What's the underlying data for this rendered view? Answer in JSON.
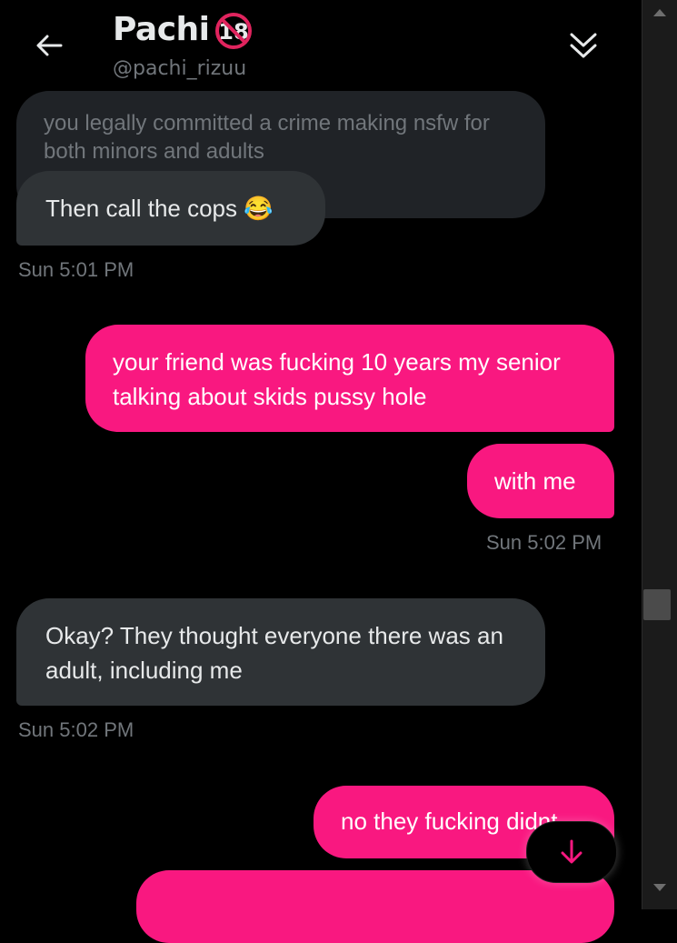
{
  "header": {
    "name": "Pachi",
    "handle": "@pachi_rizuu",
    "badge_text": "18"
  },
  "messages": {
    "quoted": "you legally committed a crime making nsfw for both minors and adults",
    "m1": "Then call the cops 😂",
    "t1": "Sun 5:01 PM",
    "m2": "your friend was fucking 10 years my senior talking about skids pussy hole",
    "m3": "with me",
    "t2": "Sun 5:02 PM",
    "m4": "Okay? They thought everyone there was an adult, including me",
    "t3": "Sun 5:02 PM",
    "m5": "no they fucking didnt"
  },
  "colors": {
    "accent": "#f91880",
    "incoming": "#2f3336",
    "background": "#000000",
    "muted": "#71767b"
  },
  "icons": {
    "back": "arrow-left-icon",
    "collapse": "double-chevron-down-icon",
    "jump": "arrow-down-icon",
    "badge": "no-under-18-icon"
  }
}
